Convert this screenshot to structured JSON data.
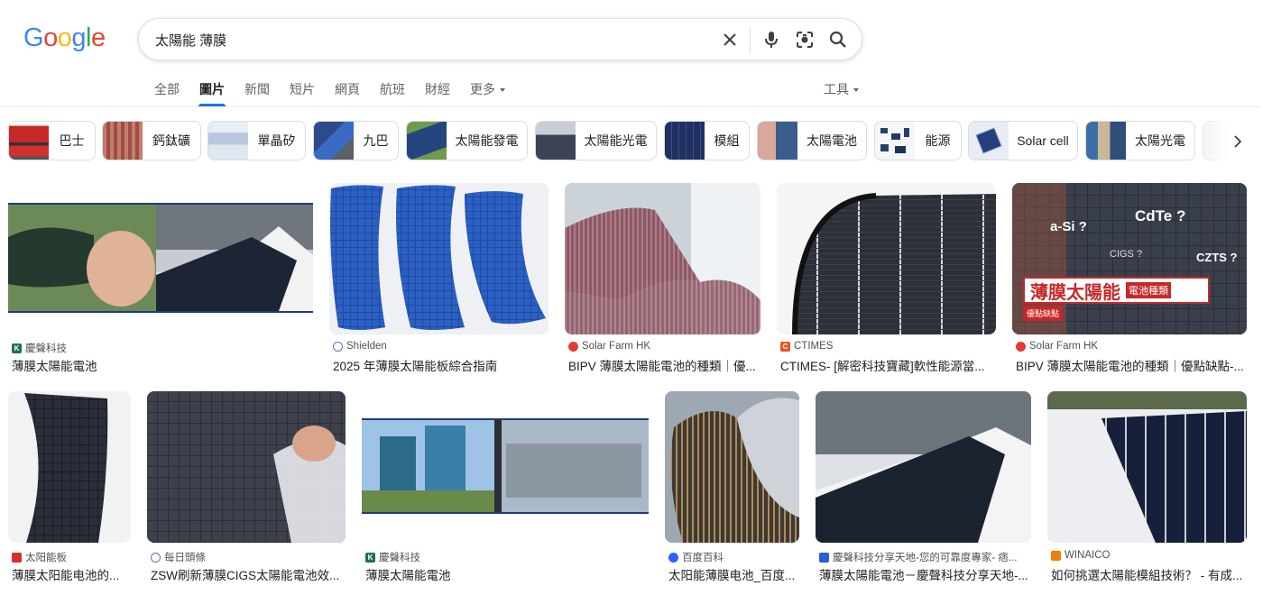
{
  "logo": "Google",
  "search": {
    "query": "太陽能 薄膜"
  },
  "nav": {
    "tabs": [
      {
        "label": "全部",
        "active": false
      },
      {
        "label": "圖片",
        "active": true
      },
      {
        "label": "新聞",
        "active": false
      },
      {
        "label": "短片",
        "active": false
      },
      {
        "label": "網頁",
        "active": false
      },
      {
        "label": "航班",
        "active": false
      },
      {
        "label": "財經",
        "active": false
      }
    ],
    "more_label": "更多",
    "tools_label": "工具"
  },
  "chips": [
    {
      "label": "巴士"
    },
    {
      "label": "鈣鈦礦"
    },
    {
      "label": "單晶矽"
    },
    {
      "label": "九巴"
    },
    {
      "label": "太陽能發電"
    },
    {
      "label": "太陽能光電"
    },
    {
      "label": "模組"
    },
    {
      "label": "太陽電池"
    },
    {
      "label": "能源"
    },
    {
      "label": "Solar cell"
    },
    {
      "label": "太陽光電"
    }
  ],
  "results": [
    {
      "source": "慶聲科技",
      "title": "薄膜太陽能電池"
    },
    {
      "source": "Shielden",
      "title": "2025 年薄膜太陽能板綜合指南"
    },
    {
      "source": "Solar Farm HK",
      "title": "BIPV 薄膜太陽能電池的種類｜優..."
    },
    {
      "source": "CTIMES",
      "title": "CTIMES- [解密科技寶藏]軟性能源當..."
    },
    {
      "source": "Solar Farm HK",
      "title": "BIPV 薄膜太陽能電池的種類｜優點缺點-..."
    },
    {
      "source": "太阳能板",
      "title": "薄膜太阳能电池的..."
    },
    {
      "source": "每日頭條",
      "title": "ZSW刷新薄膜CIGS太陽能電池效..."
    },
    {
      "source": "慶聲科技",
      "title": "薄膜太陽能電池"
    },
    {
      "source": "百度百科",
      "title": "太阳能薄膜电池_百度..."
    },
    {
      "source": "慶聲科技分享天地-您的可靠度專家- 痞...",
      "title": "薄膜太陽能電池－慶聲科技分享天地-..."
    },
    {
      "source": "WINAICO",
      "title": "如何挑選太陽能模組技術？ - 有成..."
    }
  ],
  "image_overlays": {
    "r5_labels": [
      "a-Si ?",
      "CdTe ?",
      "CIGS ?",
      "CZTS ?"
    ],
    "r5_banner": "薄膜太陽能",
    "r5_banner_sub": "電池種類",
    "r5_tag": "優點缺點"
  },
  "colors": {
    "accent": "#1a73e8",
    "text_primary": "#202124",
    "text_secondary": "#5f6368"
  }
}
